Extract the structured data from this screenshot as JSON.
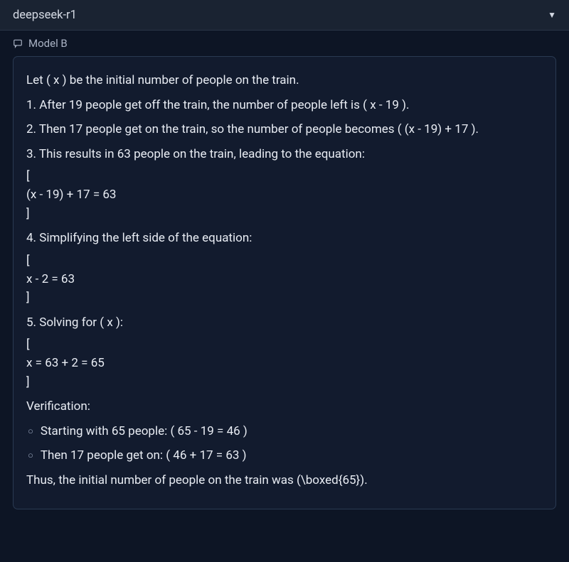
{
  "header": {
    "model_name": "deepseek-r1"
  },
  "panel": {
    "label": "Model B"
  },
  "content": {
    "p0": "Let ( x ) be the initial number of people on the train.",
    "p1": "1. After 19 people get off the train, the number of people left is ( x - 19 ).",
    "p2": "2. Then 17 people get on the train, so the number of people becomes ( (x - 19) + 17 ).",
    "p3": "3. This results in 63 people on the train, leading to the equation:",
    "eq1_open": "[",
    "eq1_body": "(x - 19) + 17 = 63",
    "eq1_close": "]",
    "p4": "4. Simplifying the left side of the equation:",
    "eq2_open": "[",
    "eq2_body": "x - 2 = 63",
    "eq2_close": "]",
    "p5": "5. Solving for ( x ):",
    "eq3_open": "[",
    "eq3_body": "x = 63 + 2 = 65",
    "eq3_close": "]",
    "p6": "Verification:",
    "b1": "Starting with 65 people: ( 65 - 19 = 46 )",
    "b2": "Then 17 people get on: ( 46 + 17 = 63 )",
    "p7": "Thus, the initial number of people on the train was (\\boxed{65})."
  }
}
